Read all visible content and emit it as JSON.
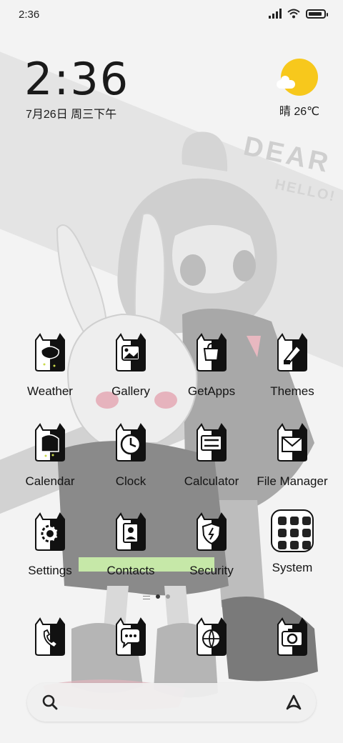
{
  "status_bar": {
    "time": "2:36",
    "battery_level": 0.9
  },
  "clock_widget": {
    "time": "2:36",
    "date": "7月26日 周三下午"
  },
  "weather_widget": {
    "condition": "晴",
    "temperature": "26℃",
    "icon": "sunny-with-cloud-icon",
    "sun_color": "#f7c81c"
  },
  "wallpaper": {
    "text_large": "DEAR",
    "text_small": "HELLO!"
  },
  "apps": [
    {
      "label": "Weather",
      "icon": "weather-icon"
    },
    {
      "label": "Gallery",
      "icon": "gallery-icon"
    },
    {
      "label": "GetApps",
      "icon": "getapps-icon"
    },
    {
      "label": "Themes",
      "icon": "themes-icon"
    },
    {
      "label": "Calendar",
      "icon": "calendar-icon"
    },
    {
      "label": "Clock",
      "icon": "clock-icon"
    },
    {
      "label": "Calculator",
      "icon": "calculator-icon"
    },
    {
      "label": "File Manager",
      "icon": "file-manager-icon"
    },
    {
      "label": "Settings",
      "icon": "settings-icon"
    },
    {
      "label": "Contacts",
      "icon": "contacts-icon"
    },
    {
      "label": "Security",
      "icon": "security-icon"
    },
    {
      "label": "System",
      "icon": "folder-icon"
    }
  ],
  "dock": [
    {
      "icon": "phone-icon"
    },
    {
      "icon": "messages-icon"
    },
    {
      "icon": "browser-icon"
    },
    {
      "icon": "camera-icon"
    }
  ],
  "page_indicator": {
    "pages": 2,
    "current": 1
  },
  "search_bar": {
    "left_icon": "search-icon",
    "right_icon": "assistant-icon"
  }
}
